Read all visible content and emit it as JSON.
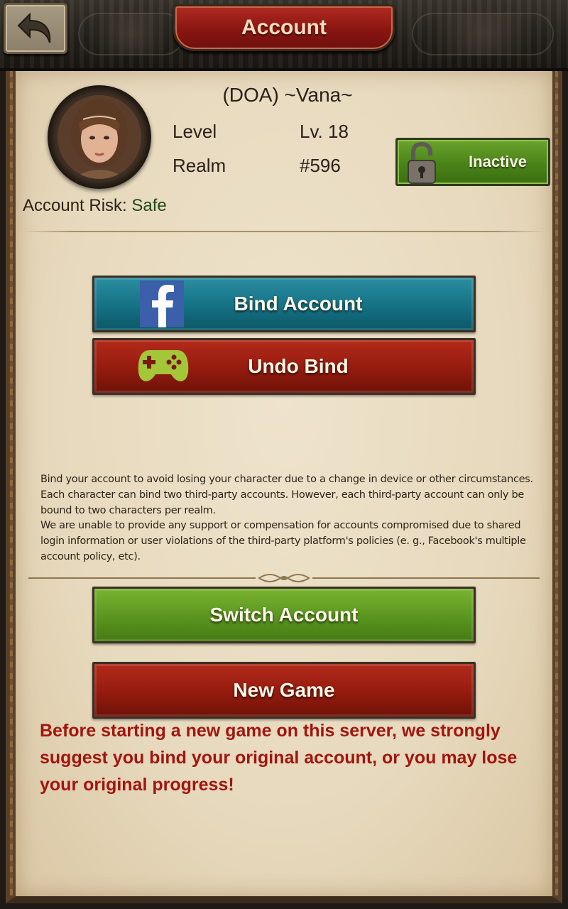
{
  "header": {
    "title": "Account",
    "back_icon": "back-arrow-icon"
  },
  "profile": {
    "name": "(DOA) ~Vana~",
    "level_label": "Level",
    "level_value": "Lv. 18",
    "realm_label": "Realm",
    "realm_value": "#596",
    "lock_status": "Inactive",
    "lock_icon": "padlock-icon",
    "risk_label": "Account Risk:",
    "risk_value": "Safe"
  },
  "binding": {
    "bind_label": "Bind Account",
    "bind_icon": "facebook-icon",
    "undo_label": "Undo Bind",
    "undo_icon": "gamepad-icon"
  },
  "info": {
    "paragraph1": "Bind your account to avoid losing your character due to a change in device or other circumstances. Each character can bind two third-party accounts. However, each third-party account can only be bound to two characters per realm.",
    "paragraph2": "We are unable to provide any support or compensation for accounts compromised due to shared login information or user violations of the third-party platform's policies (e. g., Facebook's multiple account policy, etc)."
  },
  "actions": {
    "switch_label": "Switch Account",
    "new_game_label": "New Game",
    "warning": "Before starting a new game on this server, we strongly suggest you bind your original account, or you may lose your original progress!"
  },
  "colors": {
    "warning_text": "#a2150f",
    "bind_button": "#157184",
    "undo_button": "#941b0e",
    "switch_button": "#5a9520",
    "lock_button": "#4a8418"
  }
}
